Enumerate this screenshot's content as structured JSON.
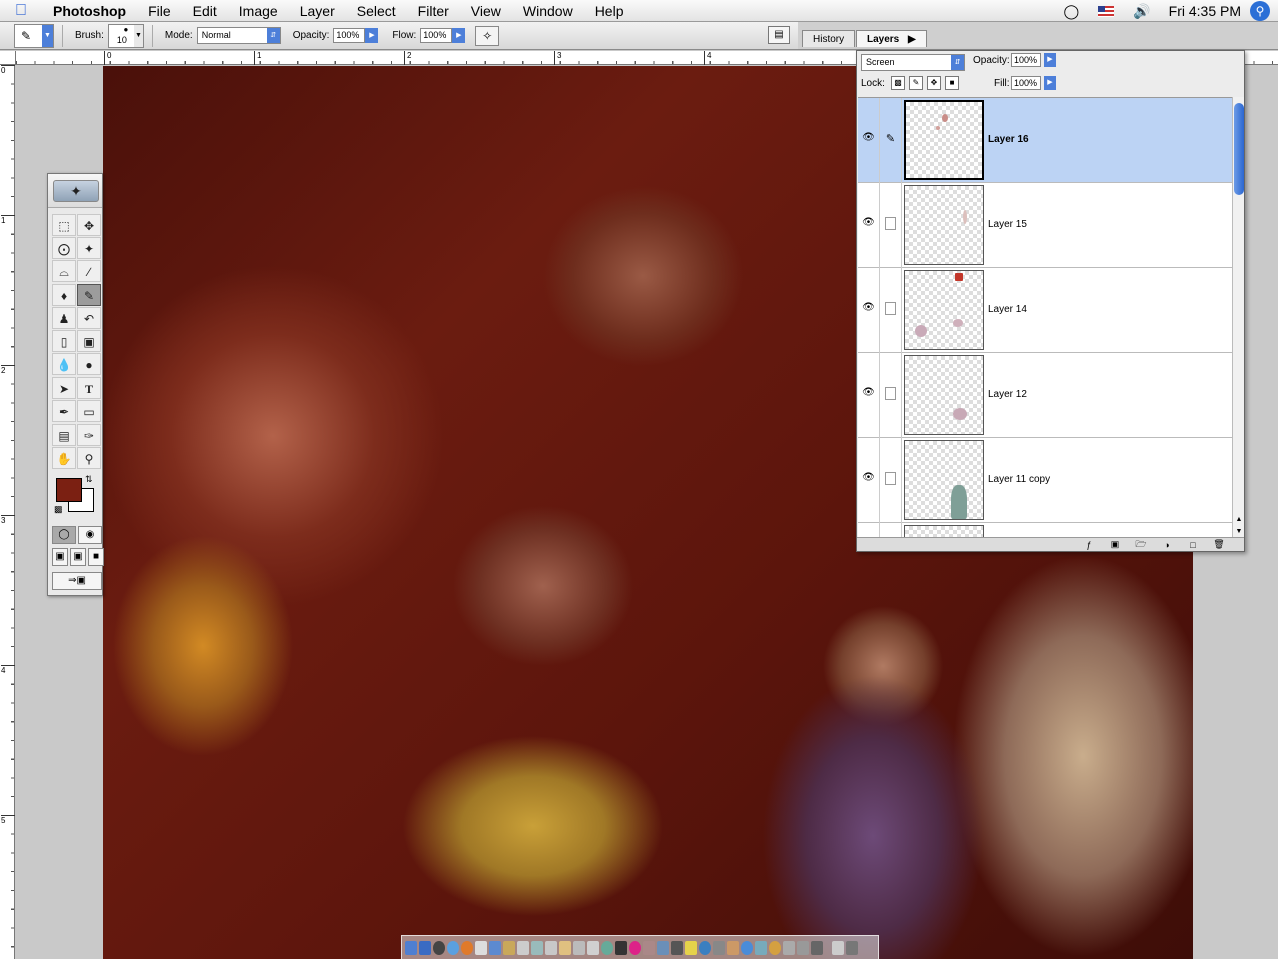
{
  "menubar": {
    "app_name": "Photoshop",
    "items": [
      "File",
      "Edit",
      "Image",
      "Layer",
      "Select",
      "Filter",
      "View",
      "Window",
      "Help"
    ],
    "clock": "Fri 4:35 PM"
  },
  "options": {
    "brush_label": "Brush:",
    "brush_size": "10",
    "mode_label": "Mode:",
    "mode_value": "Normal",
    "opacity_label": "Opacity:",
    "opacity_value": "100%",
    "flow_label": "Flow:",
    "flow_value": "100%"
  },
  "well": {
    "tabs": [
      "History",
      "Layers"
    ]
  },
  "rulers": {
    "h_labels": [
      "0",
      "1",
      "2",
      "3",
      "4"
    ],
    "v_labels": [
      "0",
      "1",
      "2",
      "3",
      "4",
      "5"
    ]
  },
  "layers_palette": {
    "blend_mode": "Screen",
    "opacity_label": "Opacity:",
    "opacity_value": "100%",
    "lock_label": "Lock:",
    "fill_label": "Fill:",
    "fill_value": "100%",
    "layers": [
      {
        "name": "Layer 16",
        "active": true
      },
      {
        "name": "Layer 15",
        "active": false
      },
      {
        "name": "Layer 14",
        "active": false
      },
      {
        "name": "Layer 12",
        "active": false
      },
      {
        "name": "Layer 11 copy",
        "active": false
      }
    ]
  },
  "toolbox": {
    "foreground_color": "#7b2012",
    "background_color": "#ffffff"
  }
}
